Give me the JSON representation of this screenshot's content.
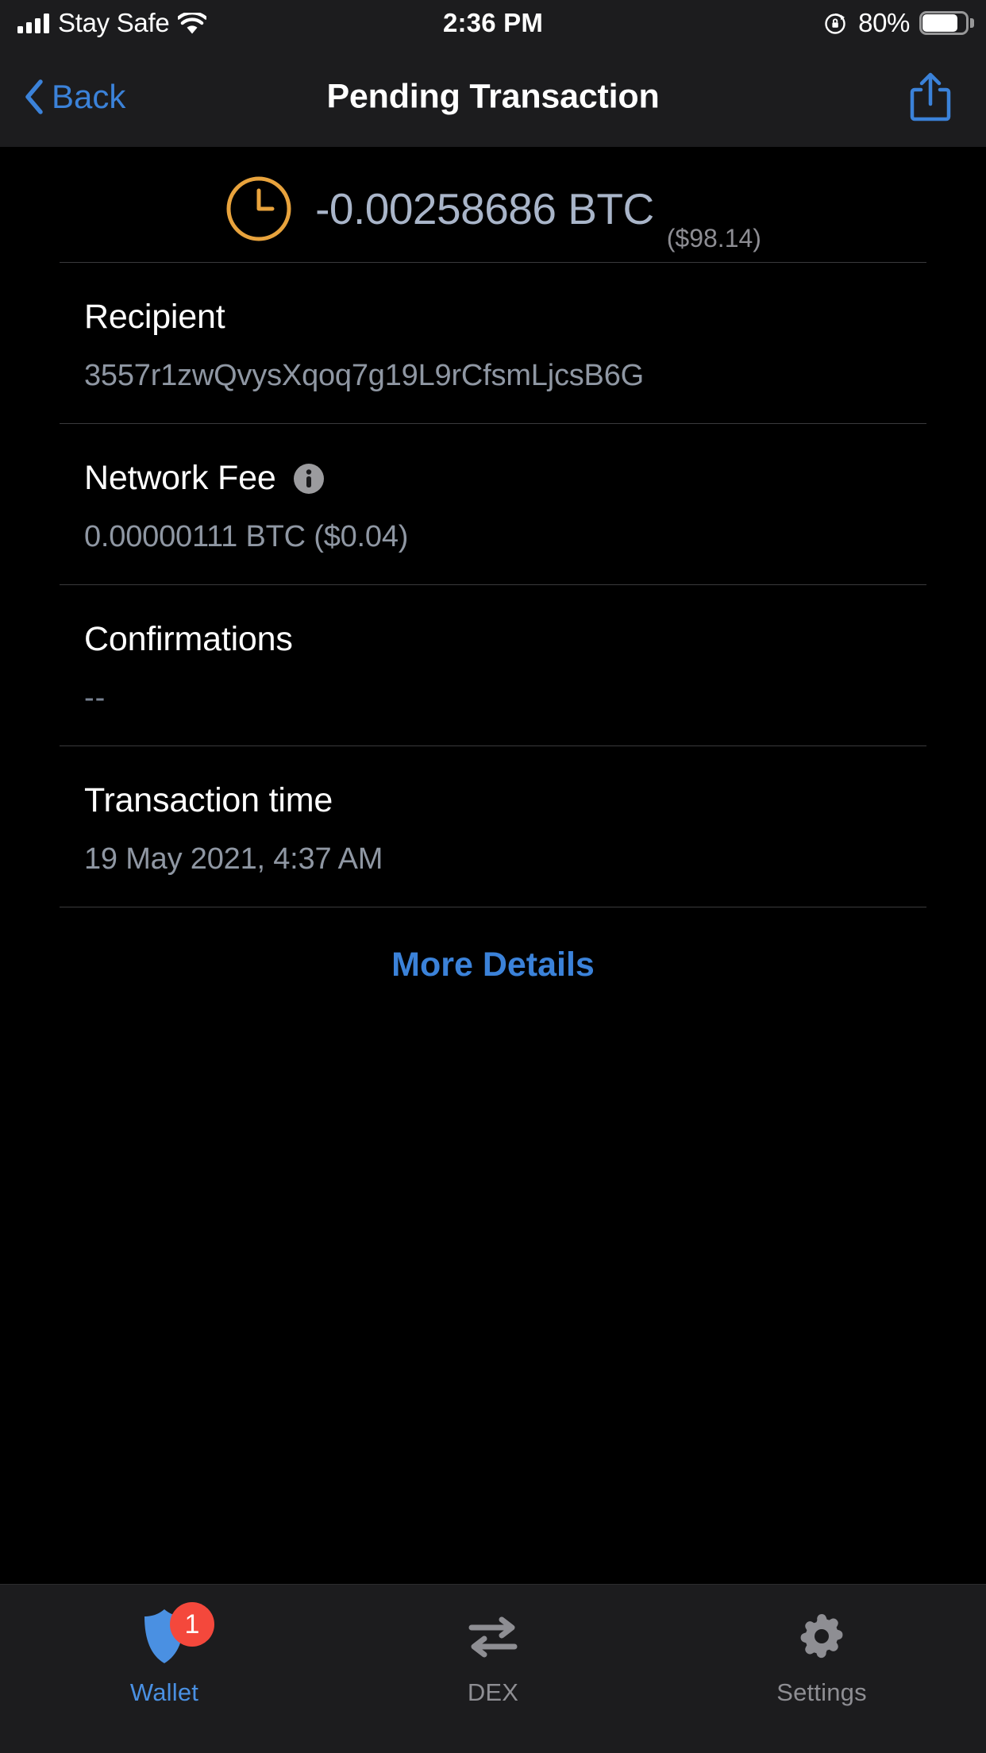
{
  "status_bar": {
    "carrier": "Stay Safe",
    "time": "2:36 PM",
    "battery_percent": "80%",
    "signal_icon": "signal-bars-icon",
    "wifi_icon": "wifi-icon",
    "rotation_lock_icon": "rotation-lock-icon",
    "battery_icon": "battery-icon"
  },
  "nav": {
    "back_label": "Back",
    "title": "Pending Transaction",
    "share_icon": "share-icon",
    "back_icon": "chevron-left-icon"
  },
  "transaction": {
    "status_icon": "clock-icon",
    "amount": "-0.00258686 BTC",
    "fiat_amount": "($98.14)",
    "rows": [
      {
        "label": "Recipient",
        "value": "3557r1zwQvysXqoq7g19L9rCfsmLjcsB6G",
        "has_info": false
      },
      {
        "label": "Network Fee",
        "value": "0.00000111 BTC ($0.04)",
        "has_info": true,
        "info_icon": "info-icon"
      },
      {
        "label": "Confirmations",
        "value": "--",
        "has_info": false
      },
      {
        "label": "Transaction time",
        "value": "19 May 2021, 4:37 AM",
        "has_info": false
      }
    ],
    "more_details_label": "More Details"
  },
  "tab_bar": {
    "tabs": [
      {
        "label": "Wallet",
        "icon": "shield-icon",
        "badge": "1",
        "active": true
      },
      {
        "label": "DEX",
        "icon": "swap-arrows-icon",
        "badge": null,
        "active": false
      },
      {
        "label": "Settings",
        "icon": "gear-icon",
        "badge": null,
        "active": false
      }
    ]
  },
  "colors": {
    "accent_blue": "#3b82d9",
    "amount_text": "#a9b5c9",
    "pending_orange": "#e8a33d",
    "badge_red": "#f4483c",
    "bar_background": "#1c1c1e",
    "page_background": "#000000"
  }
}
